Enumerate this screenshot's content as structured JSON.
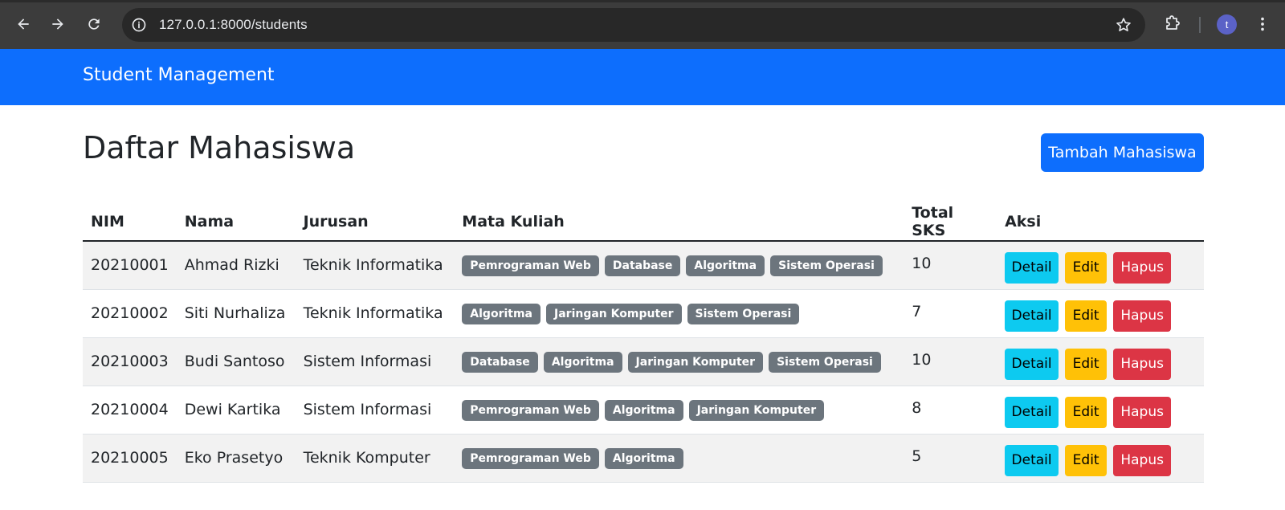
{
  "browser": {
    "url": "127.0.0.1:8000/students",
    "profile_initial": "t",
    "icons": [
      "back-arrow-icon",
      "forward-arrow-icon",
      "reload-icon",
      "site-info-icon",
      "bookmark-star-icon",
      "extensions-puzzle-icon",
      "menu-kebab-icon"
    ]
  },
  "navbar": {
    "brand": "Student Management",
    "color": "#0d6efd"
  },
  "page": {
    "title": "Daftar Mahasiswa",
    "add_button": "Tambah Mahasiswa"
  },
  "table": {
    "headers": [
      "NIM",
      "Nama",
      "Jurusan",
      "Mata Kuliah",
      "Total SKS",
      "Aksi"
    ],
    "actions": {
      "detail": "Detail",
      "edit": "Edit",
      "hapus": "Hapus"
    },
    "rows": [
      {
        "nim": "20210001",
        "nama": "Ahmad Rizki",
        "jurusan": "Teknik Informatika",
        "mata_kuliah": [
          "Pemrograman Web",
          "Database",
          "Algoritma",
          "Sistem Operasi"
        ],
        "total_sks": "10"
      },
      {
        "nim": "20210002",
        "nama": "Siti Nurhaliza",
        "jurusan": "Teknik Informatika",
        "mata_kuliah": [
          "Algoritma",
          "Jaringan Komputer",
          "Sistem Operasi"
        ],
        "total_sks": "7"
      },
      {
        "nim": "20210003",
        "nama": "Budi Santoso",
        "jurusan": "Sistem Informasi",
        "mata_kuliah": [
          "Database",
          "Algoritma",
          "Jaringan Komputer",
          "Sistem Operasi"
        ],
        "total_sks": "10"
      },
      {
        "nim": "20210004",
        "nama": "Dewi Kartika",
        "jurusan": "Sistem Informasi",
        "mata_kuliah": [
          "Pemrograman Web",
          "Algoritma",
          "Jaringan Komputer"
        ],
        "total_sks": "8"
      },
      {
        "nim": "20210005",
        "nama": "Eko Prasetyo",
        "jurusan": "Teknik Komputer",
        "mata_kuliah": [
          "Pemrograman Web",
          "Algoritma"
        ],
        "total_sks": "5"
      }
    ]
  },
  "colors": {
    "primary": "#0d6efd",
    "info": "#0dcaf0",
    "warning": "#ffc107",
    "danger": "#dc3545",
    "secondary": "#6c757d"
  }
}
